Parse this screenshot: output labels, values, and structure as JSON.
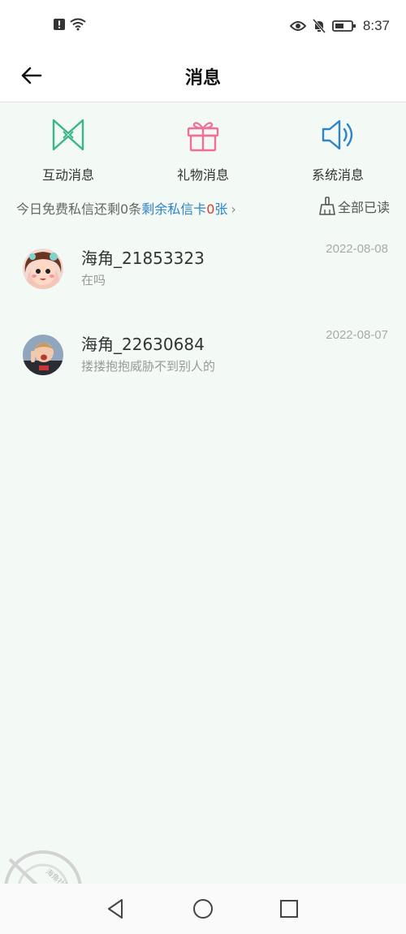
{
  "status_bar": {
    "time": "8:37"
  },
  "header": {
    "title": "消息"
  },
  "quick_actions": [
    {
      "label": "互动消息",
      "icon": "interaction-icon"
    },
    {
      "label": "礼物消息",
      "icon": "gift-icon"
    },
    {
      "label": "系统消息",
      "icon": "speaker-icon"
    }
  ],
  "notice": {
    "text": "今日免费私信还剩0条",
    "link_prefix": "剩余私信卡",
    "link_count": "0",
    "link_suffix": "张",
    "chevron": "›",
    "read_all": "全部已读"
  },
  "messages": [
    {
      "name": "海角_21853323",
      "preview": "在吗",
      "date": "2022-08-08"
    },
    {
      "name": "海角_22630684",
      "preview": "搂搂抱抱威胁不到别人的",
      "date": "2022-08-07"
    }
  ],
  "watermark": {
    "text": "海角社区",
    "url": "haijiao.com"
  },
  "colors": {
    "background": "#f3f9f5",
    "interaction_icon": "#3bb58a",
    "gift_icon": "#ef6f99",
    "speaker_icon": "#2d84c7",
    "link": "#2d84c7",
    "count": "#e0392f"
  }
}
